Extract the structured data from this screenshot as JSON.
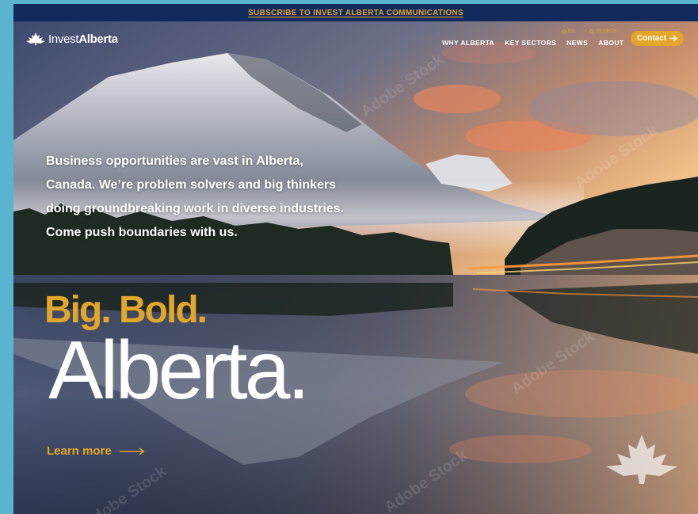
{
  "top_banner": {
    "label": "SUBSCRIBE TO INVEST ALBERTA COMMUNICATIONS"
  },
  "logo": {
    "word1": "Invest",
    "word2": "Alberta"
  },
  "utility": {
    "language": "EN",
    "search": "SEARCH"
  },
  "nav": {
    "items": [
      "WHY ALBERTA",
      "KEY SECTORS",
      "NEWS",
      "ABOUT"
    ],
    "contact_label": "Contact"
  },
  "hero": {
    "intro_lines": [
      "Business opportunities are vast in Alberta,",
      "Canada. We’re problem solvers and big thinkers",
      "doing groundbreaking work in diverse industries.",
      "Come push boundaries with us."
    ],
    "headline_1": "Big. Bold.",
    "headline_2": "Alberta.",
    "cta_label": "Learn more"
  },
  "watermark": "Adobe Stock",
  "colors": {
    "accent": "#e2a62a",
    "banner_bg": "#102a5e",
    "outer_bg": "#5bb4cf"
  },
  "icons": [
    "maple-leaf-icon",
    "globe-icon",
    "search-icon",
    "arrow-right-icon",
    "long-arrow-icon"
  ]
}
